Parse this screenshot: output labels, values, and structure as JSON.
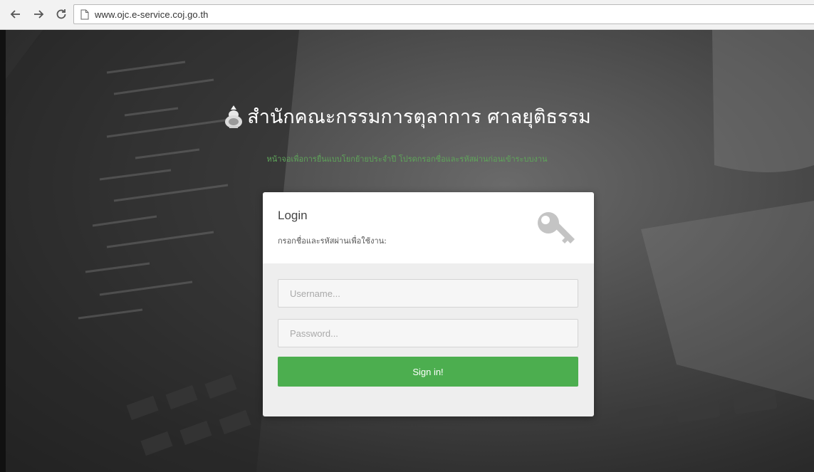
{
  "browser": {
    "url": "www.ojc.e-service.coj.go.th",
    "icons": {
      "back": "back-arrow-icon",
      "forward": "forward-arrow-icon",
      "reload": "reload-icon",
      "page": "page-icon"
    }
  },
  "header": {
    "title": "สำนักคณะกรรมการตุลาการ ศาลยุติธรรม",
    "subtitle": "หน้าจอเพื่อการยื่นแบบโยกย้ายประจำปี โปรดกรอกชื่อและรหัสผ่านก่อนเข้าระบบงาน",
    "subtitle_color": "#5fa65a"
  },
  "login": {
    "title": "Login",
    "subtitle": "กรอกชื่อและรหัสผ่านเพื่อใช้งาน:",
    "username_placeholder": "Username...",
    "password_placeholder": "Password...",
    "signin_label": "Sign in!",
    "signin_color": "#4cae4f"
  }
}
